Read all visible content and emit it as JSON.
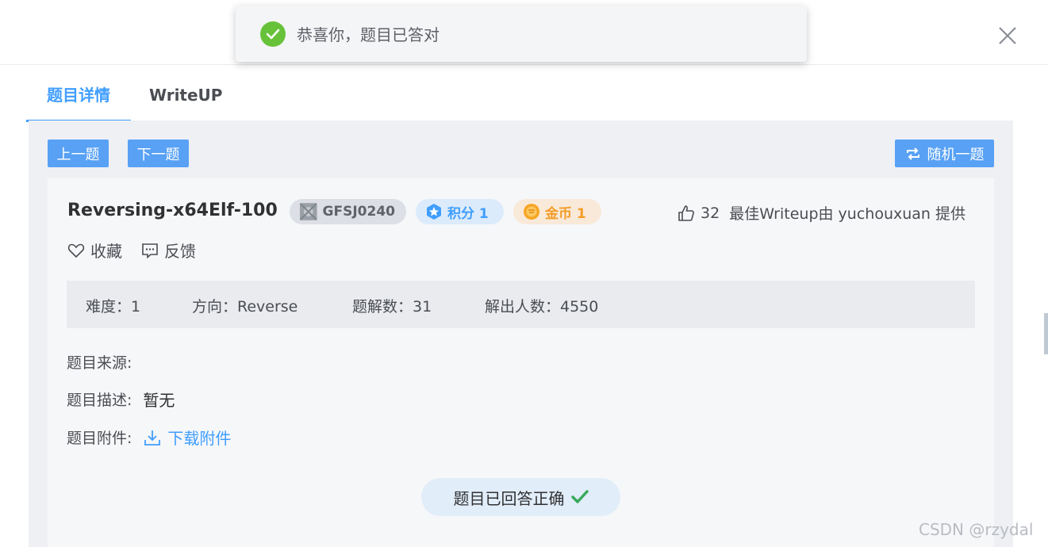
{
  "toast": {
    "message": "恭喜你，题目已答对",
    "icon": "check-circle-icon"
  },
  "tabs": [
    {
      "label": "题目详情",
      "active": true
    },
    {
      "label": "WriteUP",
      "active": false
    }
  ],
  "toolbar": {
    "prev_label": "上一题",
    "next_label": "下一题",
    "random_label": "随机一题"
  },
  "challenge": {
    "title": "Reversing-x64Elf-100",
    "tags": {
      "id": "GFSJ0240",
      "score": "积分 1",
      "gold": "金币 1"
    },
    "likes": "32",
    "best_writeup": "最佳Writeup由 yuchouxuan 提供",
    "actions": {
      "favorite": "收藏",
      "feedback": "反馈"
    },
    "info": {
      "difficulty": "难度：1",
      "direction": "方向：Reverse",
      "solves": "题解数：31",
      "solvers": "解出人数：4550"
    },
    "source_label": "题目来源:",
    "description_label": "题目描述:",
    "description_value": "暂无",
    "attachment_label": "题目附件:",
    "download_label": "下载附件",
    "answered_label": "题目已回答正确"
  },
  "watermark": "CSDN @rzydal",
  "colors": {
    "primary": "#409eff",
    "button": "#58a1f5",
    "success": "#67c23a",
    "gold": "#f39c26"
  }
}
